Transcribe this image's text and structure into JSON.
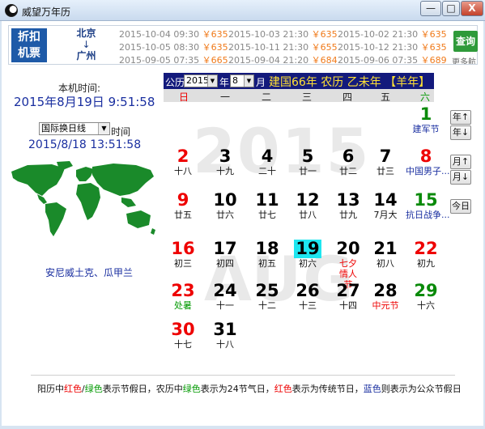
{
  "window": {
    "title": "威望万年历",
    "minimize": "—",
    "maximize": "□",
    "close": "X"
  },
  "banner": {
    "badge_line1": "折扣",
    "badge_line2": "机票",
    "route_from": "北京",
    "route_arrow": "↓",
    "route_to": "广州",
    "fares": [
      [
        {
          "time": "2015-10-04 09:30",
          "price": "￥635"
        },
        {
          "time": "2015-10-03 21:30",
          "price": "￥635"
        },
        {
          "time": "2015-10-02 21:30",
          "price": "￥635"
        }
      ],
      [
        {
          "time": "2015-10-05 08:30",
          "price": "￥635"
        },
        {
          "time": "2015-10-11 21:30",
          "price": "￥655"
        },
        {
          "time": "2015-10-12 21:30",
          "price": "￥635"
        }
      ],
      [
        {
          "time": "2015-09-05 07:35",
          "price": "￥665"
        },
        {
          "time": "2015-09-04 21:20",
          "price": "￥684"
        },
        {
          "time": "2015-09-06 07:35",
          "price": "￥689"
        }
      ]
    ],
    "query_button": "查询",
    "more": "更多航"
  },
  "clock": {
    "local_label": "本机时间:",
    "local_time": "2015年8月19日  9:51:58",
    "timezone_selected": "国际换日线",
    "time_label": "时间",
    "timezone_time": "2015/8/18 13:51:58",
    "region": "安尼威土克、瓜甲兰",
    "map_color": "#1a8a2a"
  },
  "calendar": {
    "gregorian_label": "公历",
    "year": "2015",
    "year_label": "年",
    "month": "8",
    "month_label": "月",
    "lunar_info": "建国66年  农历  乙未年  【羊年】",
    "weekdays": [
      "日",
      "一",
      "二",
      "三",
      "四",
      "五",
      "六"
    ],
    "watermark_year": "2015",
    "watermark_month": "AUG",
    "days": [
      {
        "d": "1",
        "s": "建军节",
        "dc": "green",
        "sc": "public"
      },
      {
        "d": "2",
        "s": "十八",
        "dc": "red",
        "sc": ""
      },
      {
        "d": "3",
        "s": "十九",
        "dc": "",
        "sc": ""
      },
      {
        "d": "4",
        "s": "二十",
        "dc": "",
        "sc": ""
      },
      {
        "d": "5",
        "s": "廿一",
        "dc": "",
        "sc": ""
      },
      {
        "d": "6",
        "s": "廿二",
        "dc": "",
        "sc": ""
      },
      {
        "d": "7",
        "s": "廿三",
        "dc": "",
        "sc": ""
      },
      {
        "d": "8",
        "s": "中国男子...",
        "dc": "red",
        "sc": "public"
      },
      {
        "d": "9",
        "s": "廿五",
        "dc": "red",
        "sc": ""
      },
      {
        "d": "10",
        "s": "廿六",
        "dc": "",
        "sc": ""
      },
      {
        "d": "11",
        "s": "廿七",
        "dc": "",
        "sc": ""
      },
      {
        "d": "12",
        "s": "廿八",
        "dc": "",
        "sc": ""
      },
      {
        "d": "13",
        "s": "廿九",
        "dc": "",
        "sc": ""
      },
      {
        "d": "14",
        "s": "7月大",
        "dc": "",
        "sc": ""
      },
      {
        "d": "15",
        "s": "抗日战争...",
        "dc": "green",
        "sc": "public"
      },
      {
        "d": "16",
        "s": "初三",
        "dc": "red",
        "sc": ""
      },
      {
        "d": "17",
        "s": "初四",
        "dc": "",
        "sc": ""
      },
      {
        "d": "18",
        "s": "初五",
        "dc": "",
        "sc": ""
      },
      {
        "d": "19",
        "s": "初六",
        "dc": "today",
        "sc": ""
      },
      {
        "d": "20",
        "s": "七夕情人节",
        "dc": "",
        "sc": "festival"
      },
      {
        "d": "21",
        "s": "初八",
        "dc": "",
        "sc": ""
      },
      {
        "d": "22",
        "s": "初九",
        "dc": "red",
        "sc": ""
      },
      {
        "d": "23",
        "s": "处暑",
        "dc": "red",
        "sc": "solar"
      },
      {
        "d": "24",
        "s": "十一",
        "dc": "",
        "sc": ""
      },
      {
        "d": "25",
        "s": "十二",
        "dc": "",
        "sc": ""
      },
      {
        "d": "26",
        "s": "十三",
        "dc": "",
        "sc": ""
      },
      {
        "d": "27",
        "s": "十四",
        "dc": "",
        "sc": ""
      },
      {
        "d": "28",
        "s": "中元节",
        "dc": "",
        "sc": "festival"
      },
      {
        "d": "29",
        "s": "十六",
        "dc": "green",
        "sc": ""
      },
      {
        "d": "30",
        "s": "十七",
        "dc": "red",
        "sc": ""
      },
      {
        "d": "31",
        "s": "十八",
        "dc": "",
        "sc": ""
      }
    ],
    "year_up": "年↑",
    "year_down": "年↓",
    "month_up": "月↑",
    "month_down": "月↓",
    "today_button": "今日"
  },
  "legend": {
    "p1": "阳历中",
    "red1": "红色",
    "slash": "/",
    "green1": "绿色",
    "p2": "表示节假日，农历中",
    "green2": "绿色",
    "p3": "表示为24节气日，",
    "red2": "红色",
    "p4": "表示为传统节日，",
    "blue": "蓝色",
    "p5": "则表示为公众节假日"
  },
  "colors": {
    "header_bg": "#131a7c",
    "lunar_text": "#ffe035",
    "today_bg": "#1ee6f0",
    "red": "#e00000",
    "green": "#0a8a0a",
    "blue": "#1a2fa0"
  }
}
